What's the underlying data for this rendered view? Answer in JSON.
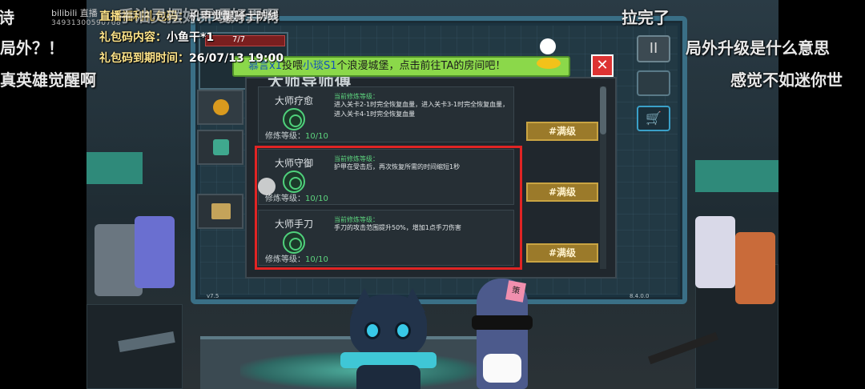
{
  "stream": {
    "platform_logo": "bilibili 直播",
    "stream_id": "34931300590768"
  },
  "danmaku": [
    {
      "text": "诗"
    },
    {
      "text": "局外？！"
    },
    {
      "text": "真英雄觉醒啊"
    },
    {
      "text": "手油灵摆好弄嘎好弄啊"
    },
    {
      "text": "拉完了"
    },
    {
      "text": "局外升级是什么意思"
    },
    {
      "text": "感觉不如迷你世"
    }
  ],
  "gift_info": {
    "line1_label": "直播福利礼包码：",
    "line1_value": "机甲觉醒骑士防线",
    "line2_label": "礼包码内容：",
    "line2_value": "小鱼干*1",
    "line3_label": "礼包码到期时间：",
    "line3_value": "26/07/13 19:00"
  },
  "hud": {
    "hp": "7/7",
    "pause_label": "II",
    "cart_icon": "cart-icon",
    "version_left": "v7.5",
    "version_right": "8.4.0.0"
  },
  "notification": {
    "sender": "慕言x1",
    "text_a": "投喂",
    "receiver": "小琰S1",
    "text_b": "个浪漫城堡，点击前往TA的房间吧！",
    "close_label": "✕"
  },
  "panel": {
    "title": "大师导师傅",
    "skills": [
      {
        "name": "大师疗愈",
        "current_label": "当前修炼等级：",
        "description": "进入关卡2-1时完全恢复血量，进入关卡3-1时完全恢复血量，进入关卡4-1时完全恢复血量",
        "level_label": "修炼等级：",
        "level_value": "10/10",
        "button": "#满级"
      },
      {
        "name": "大师守御",
        "current_label": "当前修炼等级：",
        "description": "护甲在受击后，再次恢复所需的时间缩短1秒",
        "level_label": "修炼等级：",
        "level_value": "10/10",
        "button": "#满级"
      },
      {
        "name": "大师手刀",
        "current_label": "当前修炼等级：",
        "description": "手刀的攻击范围提升50%，增加1点手刀伤害",
        "level_label": "修炼等级：",
        "level_value": "10/10",
        "button": "#满级"
      }
    ]
  },
  "colors": {
    "highlight": "#e02424",
    "gold_button": "#9b7a2a",
    "level_green": "#5dd47e",
    "notify_bg": "#8bd84a",
    "notify_user": "#1553b8"
  }
}
